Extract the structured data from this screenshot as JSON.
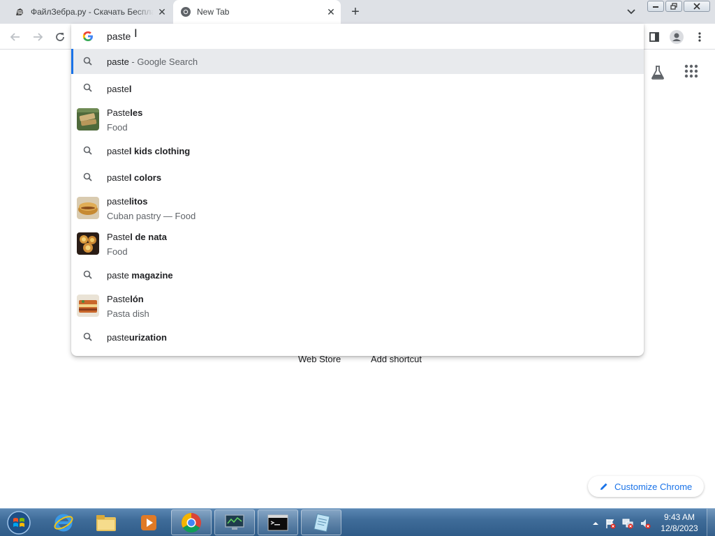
{
  "browser": {
    "tabs": [
      {
        "title": "ФайлЗебра.ру - Скачать Бесплатно",
        "close": "✕",
        "favicon": "zebra-icon"
      },
      {
        "title": "New Tab",
        "close": "✕",
        "favicon": "chrome-icon"
      }
    ],
    "new_tab": "+",
    "tab_search": "chevron-down-icon"
  },
  "omnibox": {
    "typed": "paste",
    "suggestions": [
      {
        "kind": "search",
        "typed": "paste",
        "rest": "",
        "hint": " - Google Search",
        "selected": true
      },
      {
        "kind": "search",
        "typed": "paste",
        "rest": "l"
      },
      {
        "kind": "entity",
        "typed": "Paste",
        "rest": "les",
        "sub": "Food",
        "thumb": "pasteles-thumbnail"
      },
      {
        "kind": "search",
        "typed": "paste",
        "rest": "l kids clothing"
      },
      {
        "kind": "search",
        "typed": "paste",
        "rest": "l colors"
      },
      {
        "kind": "entity",
        "typed": "paste",
        "rest": "litos",
        "sub": "Cuban pastry — Food",
        "thumb": "pastelitos-thumbnail"
      },
      {
        "kind": "entity",
        "typed": "Paste",
        "rest": "l de nata",
        "sub": "Food",
        "thumb": "pastel-de-nata-thumbnail"
      },
      {
        "kind": "search",
        "typed": "paste",
        "rest": " magazine"
      },
      {
        "kind": "entity",
        "typed": "Paste",
        "rest": "lón",
        "sub": "Pasta dish",
        "thumb": "pastelon-thumbnail"
      },
      {
        "kind": "search",
        "typed": "paste",
        "rest": "urization"
      }
    ]
  },
  "page": {
    "shortcuts": [
      {
        "label": "Web Store"
      },
      {
        "label": "Add shortcut"
      }
    ],
    "customize": "Customize Chrome"
  },
  "taskbar": {
    "clock_time": "9:43 AM",
    "clock_date": "12/8/2023"
  },
  "colors": {
    "accent": "#1a73e8",
    "tabstrip": "#dee1e6",
    "selected_row": "#e8eaed"
  }
}
